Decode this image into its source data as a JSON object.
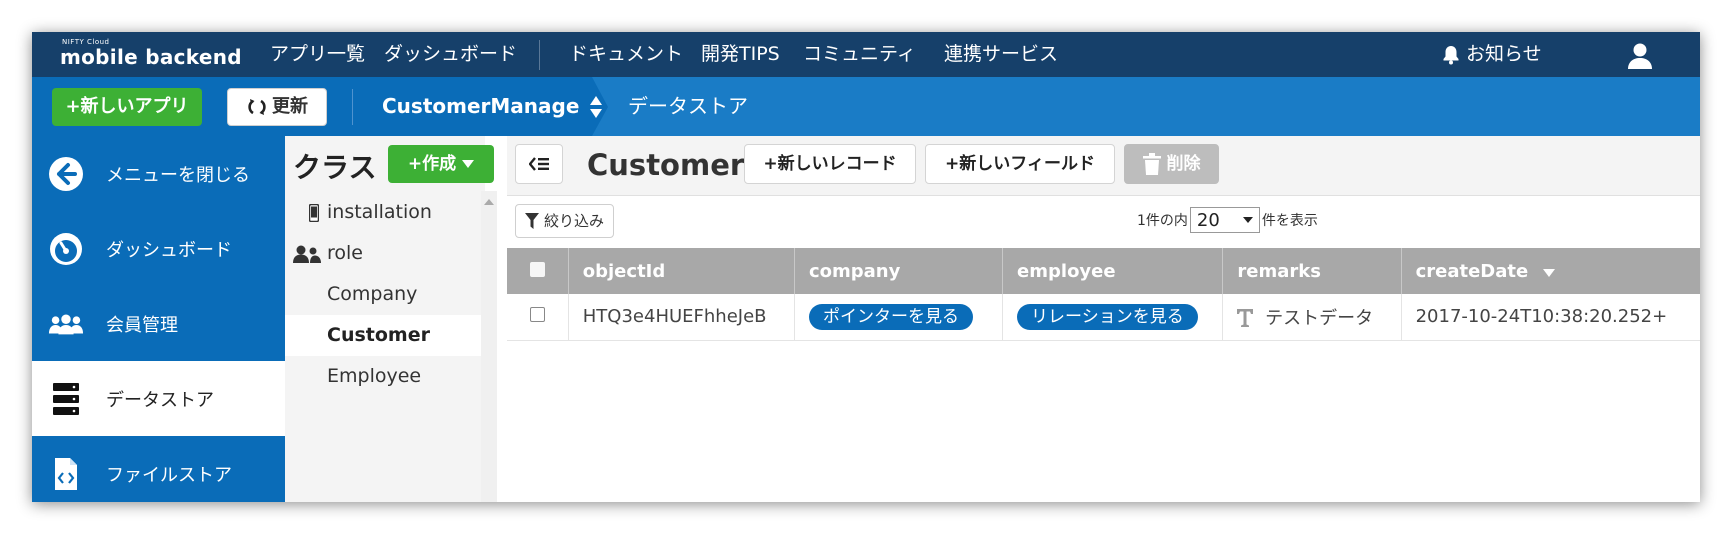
{
  "header": {
    "logo_small": "NIFTY Cloud",
    "logo_big": "mobile backend",
    "nav": [
      "アプリ一覧",
      "ダッシュボード",
      "ドキュメント",
      "開発TIPS",
      "コミュニティ",
      "連携サービス"
    ],
    "notice": "お知らせ"
  },
  "subbar": {
    "new_app": "+新しいアプリ",
    "refresh": "更新",
    "app_name": "CustomerManage",
    "breadcrumb": "データストア"
  },
  "sidebar": {
    "items": [
      {
        "label": "メニューを閉じる",
        "icon": "arrow-left-circle-icon"
      },
      {
        "label": "ダッシュボード",
        "icon": "gauge-icon"
      },
      {
        "label": "会員管理",
        "icon": "users-icon"
      },
      {
        "label": "データストア",
        "icon": "database-icon"
      },
      {
        "label": "ファイルストア",
        "icon": "file-code-icon"
      }
    ]
  },
  "classes": {
    "title": "クラス",
    "create": "+作成",
    "items": [
      "installation",
      "role",
      "Company",
      "Customer",
      "Employee"
    ],
    "active": "Customer"
  },
  "toolbar": {
    "class_name": "Customer",
    "new_record": "+新しいレコード",
    "new_field": "+新しいフィールド",
    "delete": "削除"
  },
  "filter": {
    "label": "絞り込み"
  },
  "pager": {
    "prefix": "1件の内",
    "value": "20",
    "suffix": "件を表示"
  },
  "table": {
    "columns": [
      "objectId",
      "company",
      "employee",
      "remarks",
      "createDate"
    ],
    "rows": [
      {
        "objectId": "HTQ3e4HUEFhheJeB",
        "company": "ポインターを見る",
        "employee": "リレーションを見る",
        "remarks": "テストデータ",
        "createDate": "2017-10-24T10:38:20.252+"
      }
    ]
  },
  "colors": {
    "topbar": "#16406a",
    "subbar": "#0a6cb8",
    "green": "#3db035",
    "pill": "#0a6cb8",
    "table_header": "#a8a8a8"
  }
}
